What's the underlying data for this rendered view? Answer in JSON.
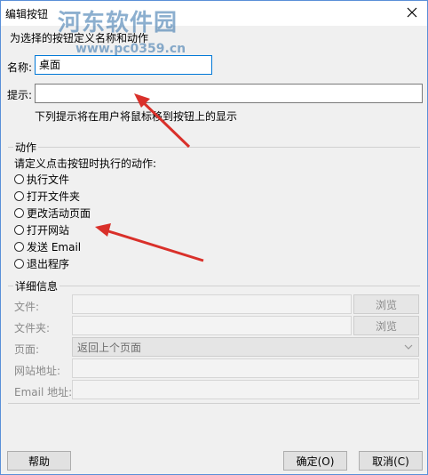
{
  "window": {
    "title": "编辑按钮",
    "subtitle": "为选择的按钮定义名称和动作"
  },
  "watermark": {
    "line1": "河东软件园",
    "line2": "www.pc0359.cn"
  },
  "fields": {
    "name_label": "名称:",
    "name_value": "桌面",
    "hint_label": "提示:",
    "hint_value": "",
    "hint_note": "下列提示将在用户将鼠标移到按钮上的显示"
  },
  "action_group": {
    "title": "动作",
    "prompt": "请定义点击按钮时执行的动作:",
    "options": [
      "执行文件",
      "打开文件夹",
      "更改活动页面",
      "打开网站",
      "发送 Email",
      "退出程序"
    ]
  },
  "details_group": {
    "title": "详细信息",
    "file_label": "文件:",
    "folder_label": "文件夹:",
    "page_label": "页面:",
    "page_value": "返回上个页面",
    "website_label": "网站地址:",
    "email_label": "Email 地址:",
    "browse_label": "浏览"
  },
  "buttons": {
    "help": "帮助",
    "ok": "确定(O)",
    "cancel": "取消(C)"
  },
  "colors": {
    "annotation_arrow": "#d9302a",
    "focus_border": "#0078d7",
    "watermark": "#2f6ea8"
  }
}
